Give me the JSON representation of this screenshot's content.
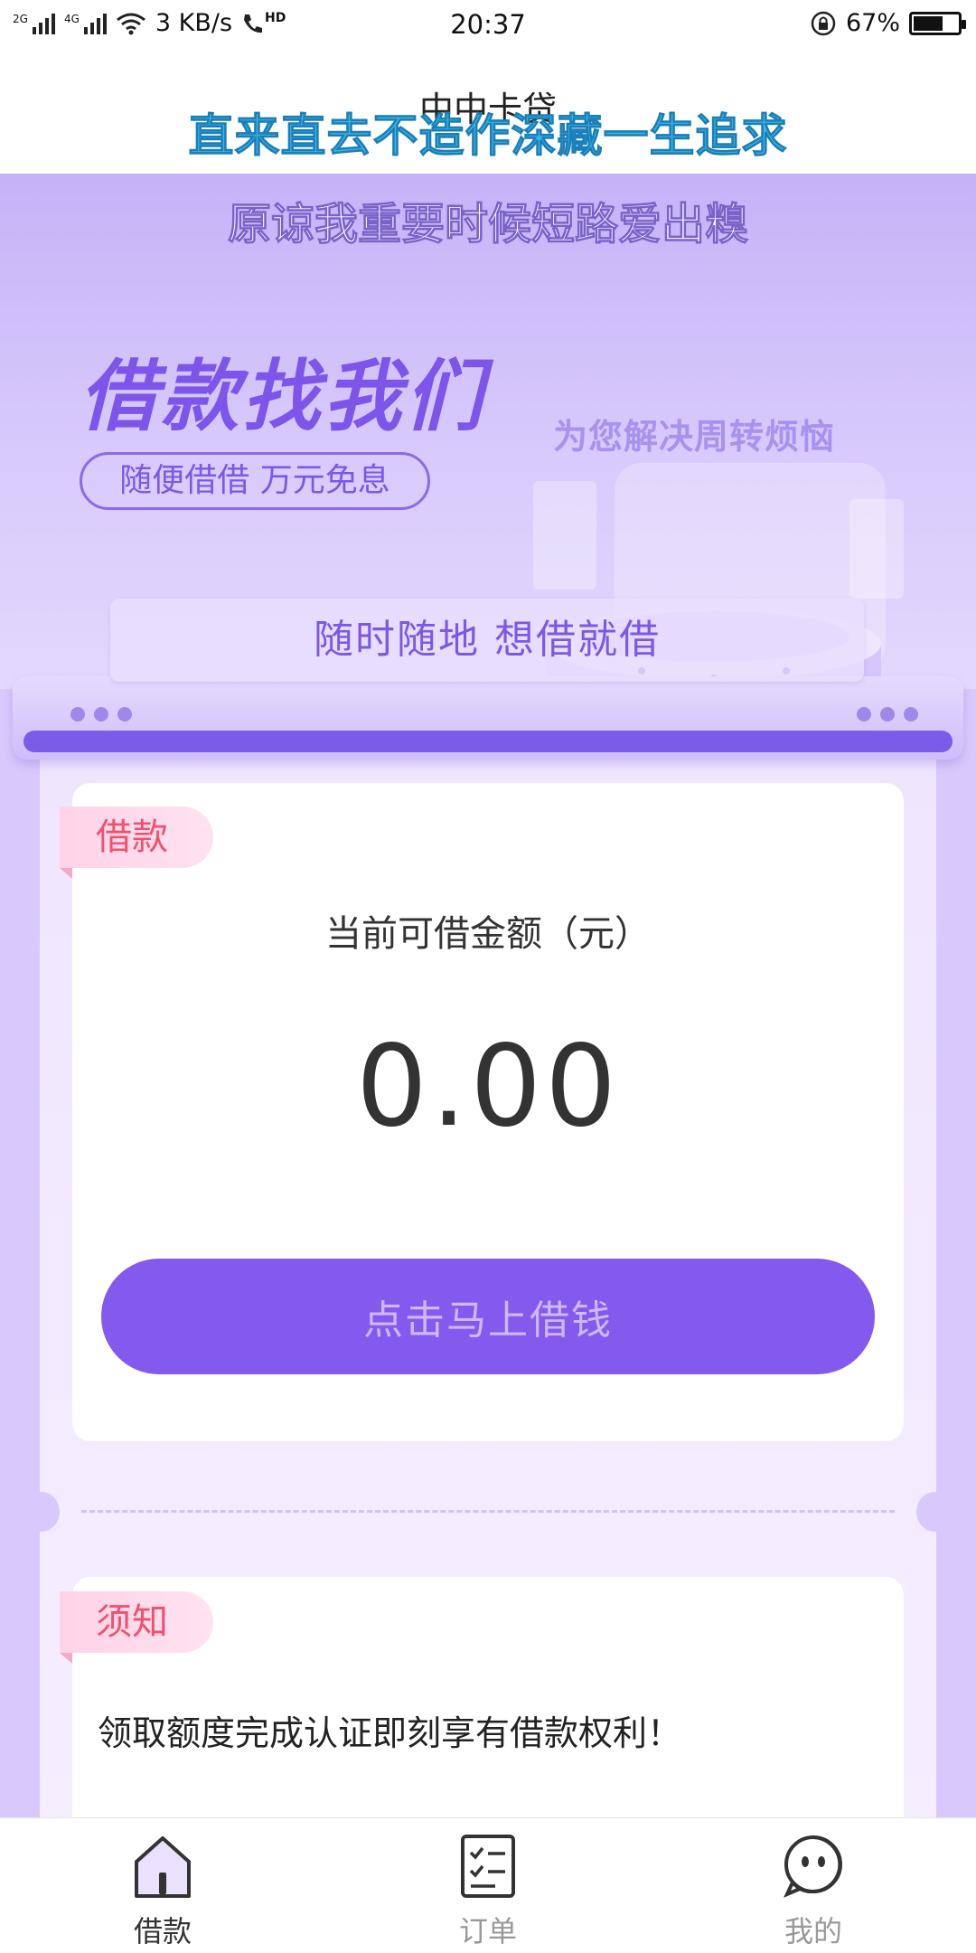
{
  "status_bar": {
    "net_speed": "3 KB/s",
    "hd_badge": "HD",
    "time": "20:37",
    "battery_percent": "67%",
    "battery_level": 0.67,
    "sim1_tag": "2G",
    "sim2_tag": "4G"
  },
  "header": {
    "app_title": "中中卡贷",
    "overlay_lyric_1": "直来直去不造作深藏一生追求",
    "overlay_lyric_2": "原谅我重要时候短路爱出糗"
  },
  "hero": {
    "title": "借款找我们",
    "pill": "随便借借 万元免息",
    "slogan": "为您解决周转烦恼",
    "sub_banner": "随时随地 想借就借"
  },
  "loan_card": {
    "tag": "借款",
    "amount_label": "当前可借金额（元）",
    "amount_value": "0.00",
    "button_label": "点击马上借钱"
  },
  "notice_card": {
    "tag": "须知",
    "text": "领取额度完成认证即刻享有借款权利！"
  },
  "bottom_nav": {
    "items": [
      {
        "label": "借款",
        "icon": "home-icon",
        "active": true
      },
      {
        "label": "订单",
        "icon": "order-list-icon",
        "active": false
      },
      {
        "label": "我的",
        "icon": "profile-face-icon",
        "active": false
      }
    ]
  },
  "colors": {
    "accent": "#8459ee",
    "tag_text": "#f0506e",
    "lyric_blue": "#3fb7e6",
    "background_lavender": "#d9c8fb"
  }
}
